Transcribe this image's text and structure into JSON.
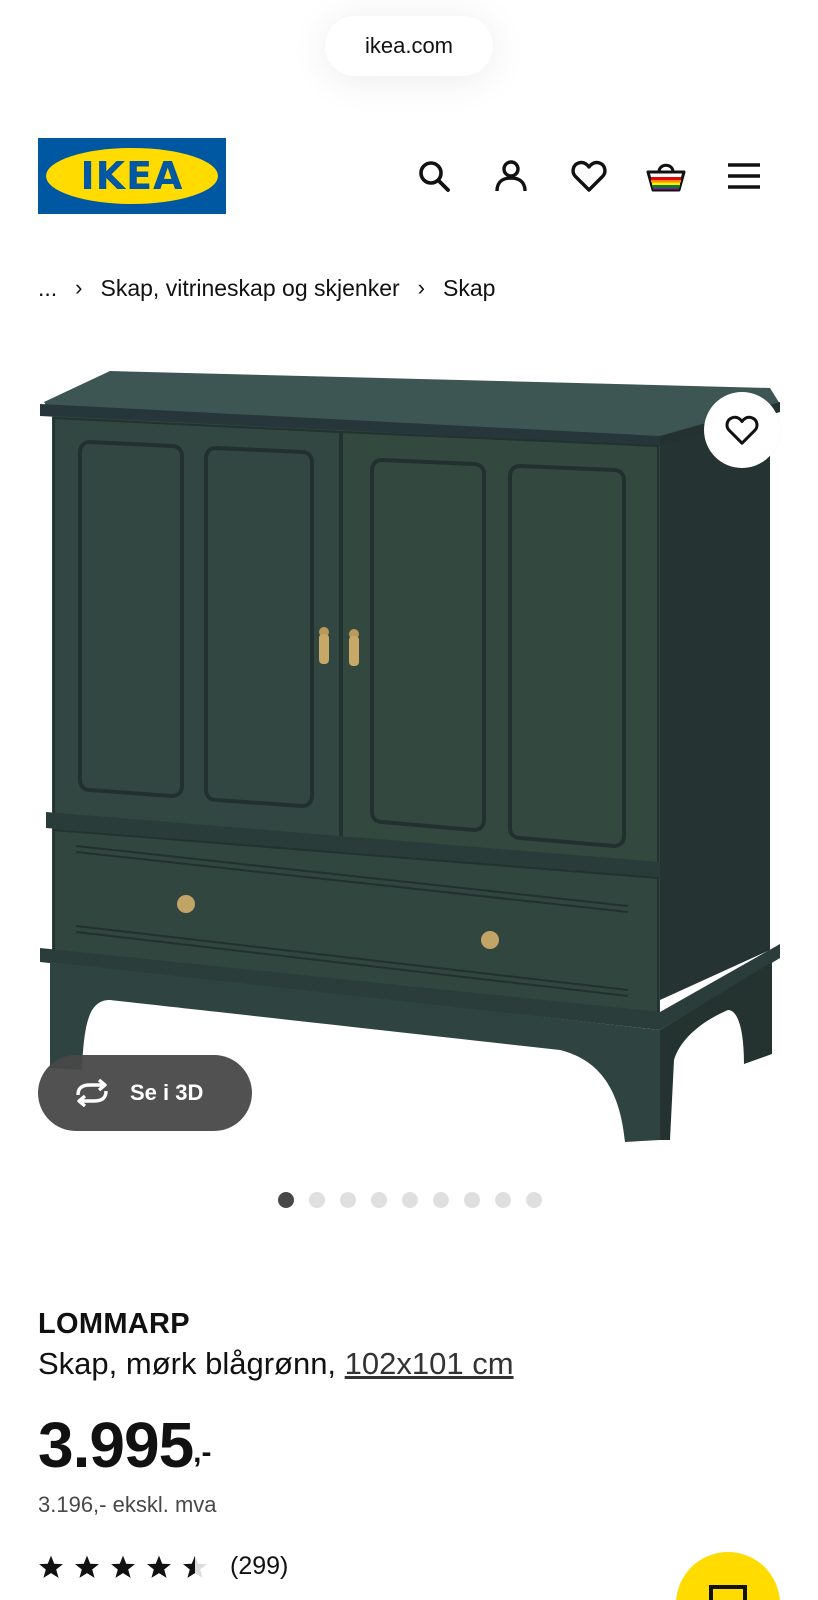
{
  "browser": {
    "url": "ikea.com"
  },
  "header": {
    "logo_text": "IKEA",
    "icons": [
      "search-icon",
      "profile-icon",
      "heart-icon",
      "basket-icon",
      "menu-icon"
    ]
  },
  "breadcrumb": {
    "ellipsis": "...",
    "items": [
      "Skap, vitrineskap og skjenker",
      "Skap"
    ]
  },
  "gallery": {
    "button_3d_label": "Se i 3D",
    "image_count": 9,
    "active_index": 0
  },
  "product": {
    "name": "LOMMARP",
    "description": "Skap, mørk blågrønn, ",
    "dimension_link": "102x101 cm",
    "price_main": "3.995",
    "price_suffix": ",-",
    "price_ex_vat": "3.196,- ekskl. mva",
    "rating_value": 4.5,
    "rating_count": "(299)"
  },
  "colors": {
    "ikea_blue": "#0058a3",
    "ikea_yellow": "#ffdb00",
    "cabinet": "#2f4341"
  }
}
